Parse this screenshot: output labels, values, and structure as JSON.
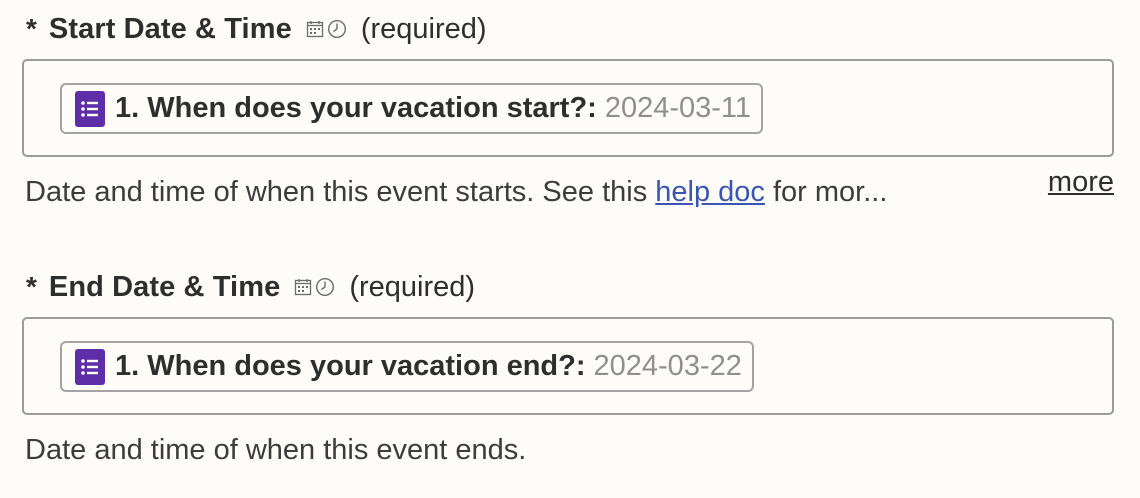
{
  "start_field": {
    "asterisk": "*",
    "label": "Start Date & Time",
    "type_icons": [
      "calendar-icon",
      "clock-icon"
    ],
    "required_text": "(required)",
    "pill": {
      "icon": "google-forms-icon",
      "question": "1. When does your vacation start?:",
      "value": "2024-03-11"
    },
    "help": {
      "prefix": "Date and time of when this event starts. See this ",
      "link_text": "help doc",
      "suffix": " for mor...",
      "more_label": "more"
    }
  },
  "end_field": {
    "asterisk": "*",
    "label": "End Date & Time",
    "type_icons": [
      "calendar-icon",
      "clock-icon"
    ],
    "required_text": "(required)",
    "pill": {
      "icon": "google-forms-icon",
      "question": "1. When does your vacation end?:",
      "value": "2024-03-22"
    },
    "help": {
      "text": "Date and time of when this event ends."
    }
  },
  "colors": {
    "forms_purple": "#5e2ea8",
    "link_blue": "#3a55b4",
    "border_gray": "#9b9b9b",
    "value_gray": "#8f8f8f",
    "background": "#fdfcf9"
  }
}
